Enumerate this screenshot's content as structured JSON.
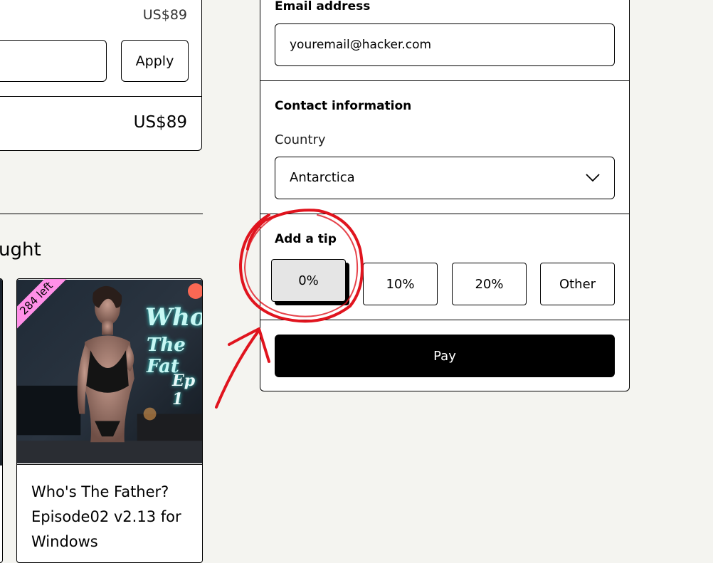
{
  "order_summary": {
    "price": "US$89",
    "apply_label": "Apply",
    "total": "US$89"
  },
  "section": {
    "heading": "ught"
  },
  "product": {
    "ribbon": "284 left",
    "thumb_title_line1": "Who's",
    "thumb_title_line2": "The Fat",
    "thumb_episode": "Ep 1",
    "title": "Who's The Father? Episode02 v2.13 for Windows"
  },
  "checkout": {
    "email_label": "Email address",
    "email_value": "youremail@hacker.com",
    "contact_label": "Contact information",
    "country_label": "Country",
    "country_value": "Antarctica",
    "tip_label": "Add a tip",
    "tips": [
      {
        "label": "0%",
        "selected": true
      },
      {
        "label": "10%",
        "selected": false
      },
      {
        "label": "20%",
        "selected": false
      },
      {
        "label": "Other",
        "selected": false
      }
    ],
    "pay_label": "Pay"
  },
  "colors": {
    "background": "#f4f4f0",
    "ribbon": "#ff90e8",
    "annotation": "#e0141e",
    "pay_button": "#000000",
    "selected_tip": "#e5e5e5"
  },
  "icons": [
    "chevron-down-icon",
    "patreon-icon"
  ]
}
